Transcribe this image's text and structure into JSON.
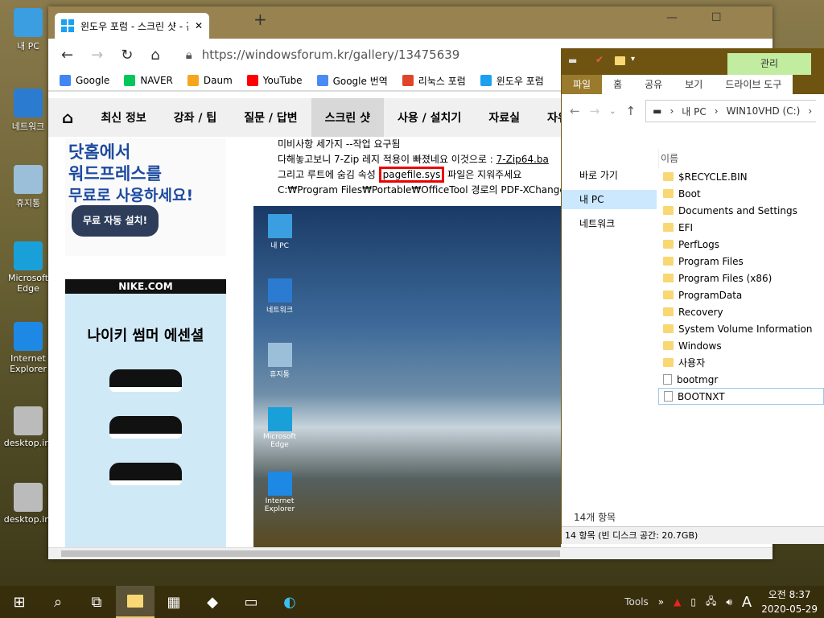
{
  "desktop": {
    "icons": [
      {
        "label": "내 PC",
        "color": "#3a9ee0"
      },
      {
        "label": "네트워크",
        "color": "#2b7bd0"
      },
      {
        "label": "휴지통",
        "color": "#9bbfd8"
      },
      {
        "label": "Microsoft Edge",
        "color": "#1aa0d8"
      },
      {
        "label": "Internet Explorer",
        "color": "#1e88e5"
      },
      {
        "label": "desktop.ini",
        "color": "#bbbbbb"
      },
      {
        "label": "desktop.ini",
        "color": "#bbbbbb"
      }
    ]
  },
  "browser": {
    "tab_title": "윈도우 포럼 - 스크린 샷 - 간결 W",
    "url": "https://windowsforum.kr/gallery/13475639",
    "bookmarks": [
      {
        "label": "Google",
        "color": "#4285f4"
      },
      {
        "label": "NAVER",
        "color": "#03c75a"
      },
      {
        "label": "Daum",
        "color": "#f7a51c"
      },
      {
        "label": "YouTube",
        "color": "#ff0000"
      },
      {
        "label": "Google 번역",
        "color": "#4a8af4"
      },
      {
        "label": "리눅스 포럼",
        "color": "#e0452a"
      },
      {
        "label": "윈도우 포럼",
        "color": "#1aa1f0"
      }
    ],
    "nav": [
      "최신 정보",
      "강좌 / 팁",
      "질문 / 답변",
      "스크린 샷",
      "사용 / 설치기",
      "자료실",
      "자유"
    ],
    "nav_active": "스크린 샷",
    "ad1": {
      "line1": "닷홈에서",
      "line2": "워드프레스를",
      "line3": "무료로 사용하세요!",
      "button": "무료 자동 설치!"
    },
    "ad2": {
      "brand": "NIKE.COM",
      "text": "나이키 썸머 에센셜"
    },
    "post": {
      "line1": "미비사항 세가지  --작업 요구됨",
      "line2a": "다해놓고보니 7-Zip 레지 적용이 빠졌네요  이것으로 : ",
      "line2_link": "7-Zip64.ba",
      "line3a": "그리고 루트에 숨김 속성 ",
      "line3_hl": "pagefile.sys",
      "line3b": " 파일은 지워주세요",
      "line4": "C:₩Program Files₩Portable₩OfficeTool 경로의 PDF-XChange"
    },
    "screenshot_icons": [
      "내 PC",
      "네트워크",
      "휴지통",
      "Microsoft Edge",
      "Internet Explorer"
    ]
  },
  "explorer": {
    "context_tab": "관리",
    "ribbon_tabs": [
      "파일",
      "홈",
      "공유",
      "보기",
      "드라이브 도구"
    ],
    "path": [
      "내 PC",
      "WIN10VHD (C:)"
    ],
    "nav_pane": [
      {
        "label": "바로 가기",
        "selected": false
      },
      {
        "label": "내 PC",
        "selected": true
      },
      {
        "label": "네트워크",
        "selected": false
      }
    ],
    "column": "이름",
    "files": [
      {
        "name": "$RECYCLE.BIN",
        "type": "folder"
      },
      {
        "name": "Boot",
        "type": "folder"
      },
      {
        "name": "Documents and Settings",
        "type": "link"
      },
      {
        "name": "EFI",
        "type": "folder"
      },
      {
        "name": "PerfLogs",
        "type": "folder"
      },
      {
        "name": "Program Files",
        "type": "folder"
      },
      {
        "name": "Program Files (x86)",
        "type": "folder"
      },
      {
        "name": "ProgramData",
        "type": "folder"
      },
      {
        "name": "Recovery",
        "type": "folder"
      },
      {
        "name": "System Volume Information",
        "type": "folder"
      },
      {
        "name": "Windows",
        "type": "folder"
      },
      {
        "name": "사용자",
        "type": "folder"
      },
      {
        "name": "bootmgr",
        "type": "file"
      },
      {
        "name": "BOOTNXT",
        "type": "file",
        "selected": true
      }
    ],
    "item_count": "14개 항목",
    "status": "14 항목 (빈 디스크 공간: 20.7GB)"
  },
  "taskbar": {
    "tools": "Tools",
    "ime": "A",
    "time": "오전 8:37",
    "date": "2020-05-29"
  }
}
